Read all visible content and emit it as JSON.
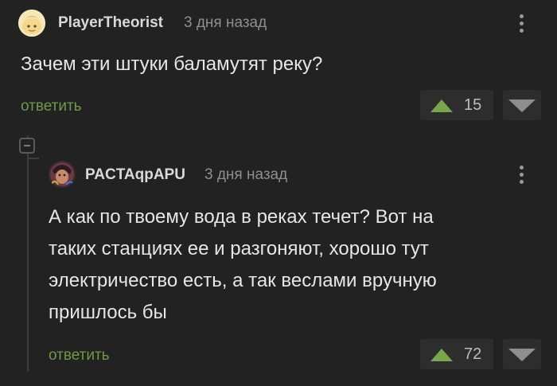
{
  "comments": [
    {
      "username": "PlayerTheorist",
      "time": "3 дня назад",
      "text": "Зачем эти штуки баламутят реку?",
      "reply_label": "ответить",
      "votes": "15"
    },
    {
      "username": "PACTAqpAPU",
      "time": "3 дня назад",
      "text_lines": [
        "А как по твоему вода в реках течет? Вот на",
        "таких станциях ее и разгоняют, хорошо тут",
        "электричество есть, а так веслами вручную",
        "пришлось бы"
      ],
      "reply_label": "ответить",
      "votes": "72"
    }
  ],
  "colors": {
    "background": "#222222",
    "reply_link": "#6e9a46",
    "upvote": "#78a64a",
    "downvote": "#8e8e8e"
  },
  "icons": [
    "avatar",
    "kebab-menu-icon",
    "upvote-arrow-icon",
    "downvote-arrow-icon",
    "collapse-thread-icon"
  ]
}
